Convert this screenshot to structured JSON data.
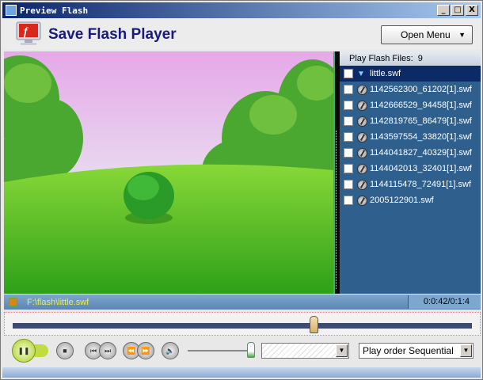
{
  "window": {
    "title": "Preview Flash",
    "minimize": "_",
    "maximize": "□",
    "close": "X"
  },
  "header": {
    "app_title": "Save Flash Player",
    "open_menu_label": "Open Menu",
    "open_menu_arrow": "▼"
  },
  "playlist": {
    "header_label": "Play Flash Files:",
    "count": "9",
    "items": [
      {
        "name": "little.swf"
      },
      {
        "name": "1142562300_61202[1].swf"
      },
      {
        "name": "1142666529_94458[1].swf"
      },
      {
        "name": "1142819765_86479[1].swf"
      },
      {
        "name": "1143597554_33820[1].swf"
      },
      {
        "name": "1144041827_40329[1].swf"
      },
      {
        "name": "1144042013_32401[1].swf"
      },
      {
        "name": "1144115478_72491[1].swf"
      },
      {
        "name": "2005122901.swf"
      }
    ]
  },
  "status": {
    "path": "F:\\flash\\little.swf",
    "time": "0:0:42/0:1:4"
  },
  "seek": {
    "progress_percent": 65.6
  },
  "controls": {
    "pause": "❚❚",
    "stop": "■",
    "prev": "⏮",
    "next": "⏭",
    "rewind": "⏪",
    "forward": "⏩",
    "mute": "🔈",
    "volume_percent": 100,
    "skin_value": "",
    "play_order": "Play order Sequential",
    "dd_arrow": "▼"
  }
}
